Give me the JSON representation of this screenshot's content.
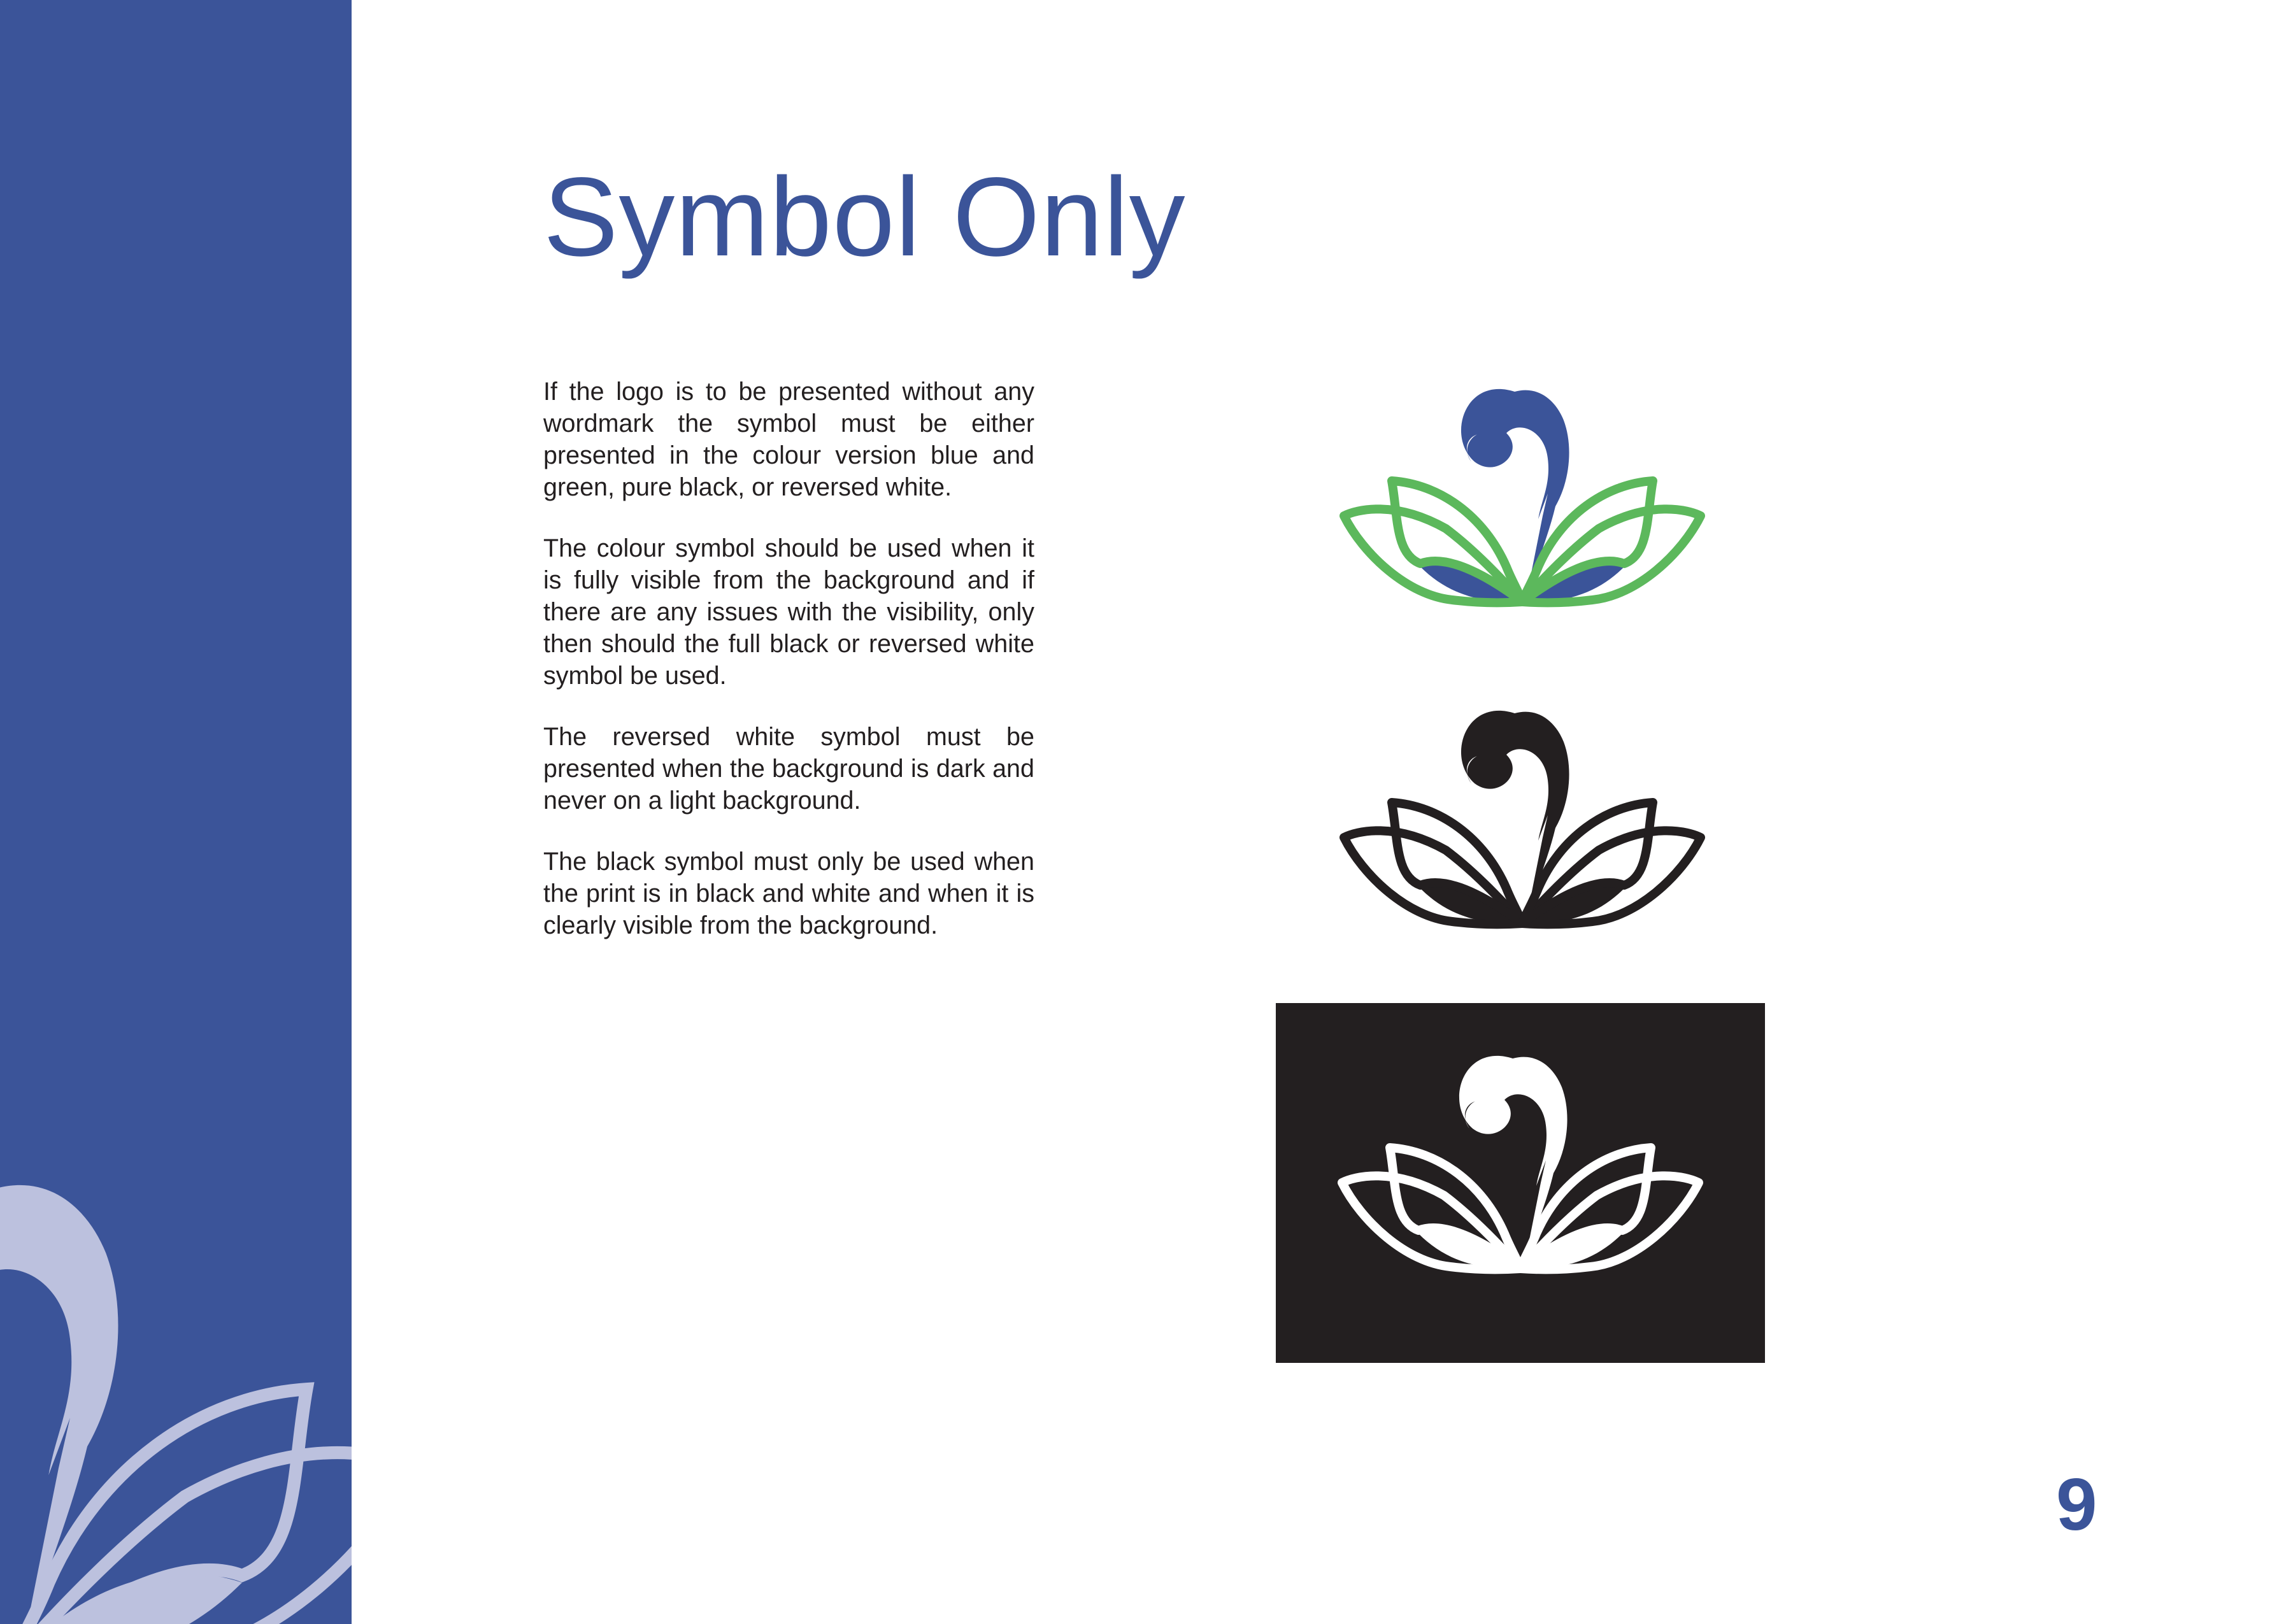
{
  "page": {
    "title": "Symbol Only",
    "page_number": "9"
  },
  "body": {
    "paragraphs": [
      "If the logo is to be presented without any wordmark the symbol must be either presented in the colour version blue and green, pure black, or reversed white.",
      "The colour symbol should be used when it is fully visible from the background and if there are any issues with the visibility, only then should the full black or reversed white symbol be used.",
      "The reversed white symbol must be presented when the background is dark and never on a light background.",
      "The black symbol must only be used when the print is in black and white and when it is clearly visible from the background."
    ]
  },
  "colors": {
    "brand_blue": "#3b5499",
    "brand_green": "#5cb85c",
    "black": "#231f20",
    "white": "#ffffff",
    "sidebar_logo_tint": "#bcc1de"
  },
  "symbols": [
    {
      "variant": "colour",
      "icon": "lotus-symbol-icon"
    },
    {
      "variant": "black",
      "icon": "lotus-symbol-icon"
    },
    {
      "variant": "reversed-white",
      "icon": "lotus-symbol-icon"
    }
  ]
}
